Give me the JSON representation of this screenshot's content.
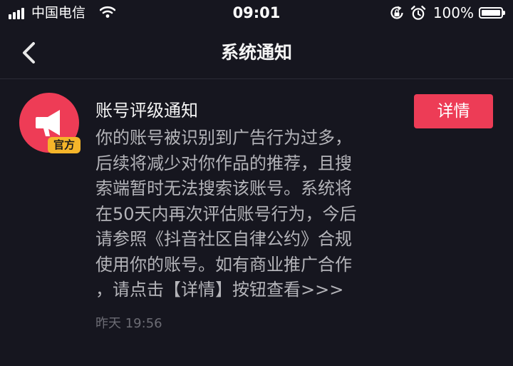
{
  "status_bar": {
    "carrier": "中国电信",
    "time": "09:01",
    "battery_percent": "100%",
    "icons": [
      "signal-icon",
      "wifi-icon",
      "rotation-lock-icon",
      "alarm-icon",
      "battery-icon"
    ]
  },
  "nav": {
    "title": "系统通知",
    "back_icon": "chevron-left-icon"
  },
  "notification": {
    "avatar_icon": "megaphone-icon",
    "badge": "官方",
    "title": "账号评级通知",
    "body_lines": [
      "你的账号被识别到广告行为过多，",
      "后续将减少对你作品的推荐，且搜",
      "索端暂时无法搜索该账号。系统将",
      "在50天内再次评估账号行为，今后",
      "请参照《抖音社区自律公约》合规",
      "使用你的账号。如有商业推广合作",
      "，请点击【详情】按钮查看>>>"
    ],
    "time": "昨天 19:56",
    "details_label": "详情"
  },
  "colors": {
    "background": "#16161f",
    "accent": "#ed3c56",
    "badge": "#f5b52a",
    "body_text": "#b4b4b9",
    "time_text": "#6c6c74"
  }
}
